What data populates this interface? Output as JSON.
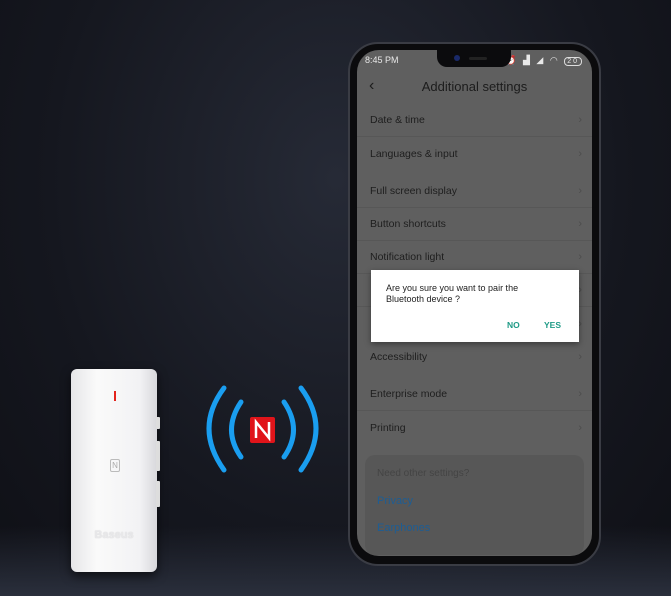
{
  "device": {
    "brand": "Baseus",
    "nfc_glyph": "N"
  },
  "nfc_symbol": {
    "glyph": "N",
    "icon": "nfc-icon",
    "wave_color": "#1a9ef0",
    "badge_color": "#e0141a"
  },
  "phone": {
    "status_bar": {
      "time": "8:45 PM",
      "icons": [
        "chat-icon",
        "bluetooth-icon",
        "alarm-icon",
        "signal-icon",
        "wifi-icon",
        "battery-icon"
      ],
      "battery": "20"
    },
    "header": {
      "title": "Additional  settings",
      "back_icon": "‹"
    },
    "settings": [
      {
        "label": "Date & time"
      },
      {
        "label": "Languages & input"
      },
      {
        "label": "Full screen display"
      },
      {
        "label": "Button shortcuts"
      },
      {
        "label": "Notification light"
      },
      {
        "label": "Accessibility"
      },
      {
        "label": "Enterprise mode"
      },
      {
        "label": "Printing"
      }
    ],
    "other": {
      "title": "Need other settings?",
      "links": [
        "Privacy",
        "Earphones"
      ]
    },
    "dialog": {
      "message": "Are you sure you want to pair the Bluetooth device ?",
      "no": "NO",
      "yes": "YES",
      "accent": "#1e9a86"
    }
  }
}
